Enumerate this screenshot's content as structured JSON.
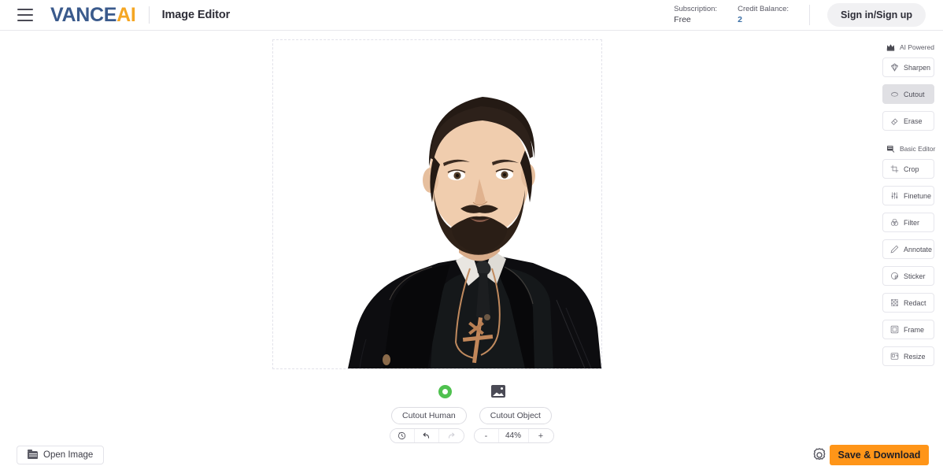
{
  "header": {
    "menu_icon": "hamburger-icon",
    "logo_part1": "VANCE",
    "logo_part2": "AI",
    "app_title": "Image Editor",
    "subscription_label": "Subscription:",
    "subscription_value": "Free",
    "credit_label": "Credit Balance:",
    "credit_value": "2",
    "signin_label": "Sign in/Sign up",
    "brand_blue": "#3a5a8c",
    "brand_orange": "#f5a623",
    "credit_color": "#3a6ea5"
  },
  "canvas": {
    "alt": "portrait of bearded man in black coat with cross pendant",
    "border_style": "dashed"
  },
  "cutout": {
    "modes": [
      {
        "label": "Cutout Human",
        "icon": "person-ring-icon",
        "selected": true,
        "color": "#4fc14f"
      },
      {
        "label": "Cutout Object",
        "icon": "image-icon",
        "selected": false
      }
    ]
  },
  "controls": {
    "history": [
      {
        "name": "reset-history-icon",
        "label": "↺",
        "disabled": false
      },
      {
        "name": "undo-icon",
        "label": "↶",
        "disabled": false
      },
      {
        "name": "redo-icon",
        "label": "↷",
        "disabled": true
      }
    ],
    "zoom_out": "-",
    "zoom_value": "44%",
    "zoom_in": "+"
  },
  "footer": {
    "open_image_label": "Open Image",
    "open_image_icon": "folder-icon",
    "settings_icon": "gear-icon",
    "save_label": "Save & Download",
    "save_color": "#ff9518"
  },
  "tools": {
    "sections": [
      {
        "title": "AI Powered",
        "icon": "crown-icon",
        "items": [
          {
            "label": "Sharpen",
            "icon": "diamond-icon",
            "active": false
          },
          {
            "label": "Cutout",
            "icon": "cutout-icon",
            "active": true
          },
          {
            "label": "Erase",
            "icon": "eraser-icon",
            "active": false
          }
        ]
      },
      {
        "title": "Basic Editor",
        "icon": "editor-icon",
        "items": [
          {
            "label": "Crop",
            "icon": "crop-icon",
            "active": false
          },
          {
            "label": "Finetune",
            "icon": "sliders-icon",
            "active": false
          },
          {
            "label": "Filter",
            "icon": "filter-icon",
            "active": false
          },
          {
            "label": "Annotate",
            "icon": "pencil-icon",
            "active": false
          },
          {
            "label": "Sticker",
            "icon": "sticker-icon",
            "active": false
          },
          {
            "label": "Redact",
            "icon": "redact-icon",
            "active": false
          },
          {
            "label": "Frame",
            "icon": "frame-icon",
            "active": false
          },
          {
            "label": "Resize",
            "icon": "resize-icon",
            "active": false
          }
        ]
      }
    ]
  }
}
